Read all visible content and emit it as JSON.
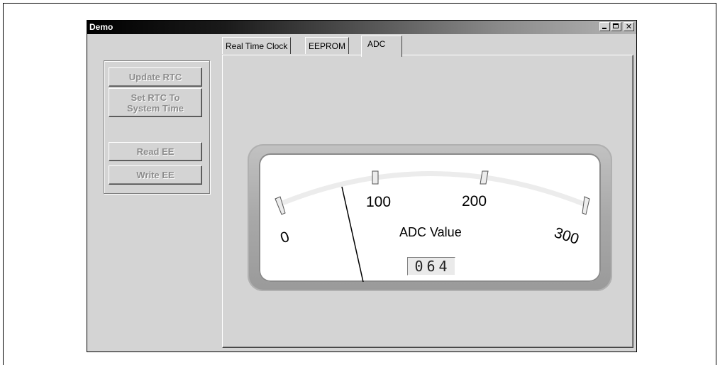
{
  "window": {
    "title": "Demo",
    "controls": {
      "minimize": "_",
      "maximize": "□",
      "close": "✕"
    }
  },
  "left_panel": {
    "buttons": {
      "update_rtc": "Update RTC",
      "set_rtc_line1": "Set RTC To",
      "set_rtc_line2": "System Time",
      "read_ee": "Read EE",
      "write_ee": "Write EE"
    }
  },
  "tabs": [
    {
      "label": "Real Time Clock",
      "active": false
    },
    {
      "label": "EEPROM",
      "active": false
    },
    {
      "label": "ADC",
      "active": true
    }
  ],
  "gauge": {
    "title": "ADC Value",
    "scale_labels": [
      "0",
      "100",
      "200",
      "300"
    ],
    "min": 0,
    "max": 300,
    "value": 64,
    "readout": "064"
  }
}
